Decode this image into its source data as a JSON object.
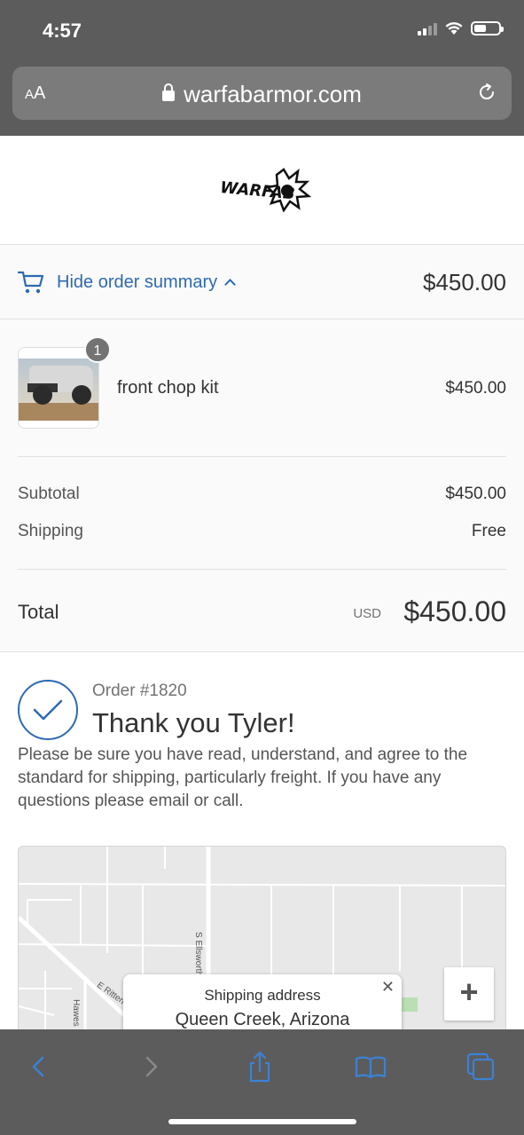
{
  "status": {
    "time": "4:57",
    "icons": [
      "cellular-signal-icon",
      "wifi-icon",
      "battery-icon"
    ]
  },
  "browser": {
    "text_size_label": "AA",
    "url": "warfabarmor.com",
    "toolbar_icons": [
      "back-icon",
      "forward-icon",
      "share-icon",
      "bookmarks-icon",
      "tabs-icon"
    ]
  },
  "header": {
    "logo_text": "WARFAB"
  },
  "order_summary": {
    "toggle_label": "Hide order summary",
    "toggle_total": "$450.00",
    "item": {
      "quantity": "1",
      "name": "front chop kit",
      "price": "$450.00"
    },
    "subtotal_label": "Subtotal",
    "subtotal_value": "$450.00",
    "shipping_label": "Shipping",
    "shipping_value": "Free",
    "total_label": "Total",
    "currency": "USD",
    "total_value": "$450.00"
  },
  "confirmation": {
    "order_number": "Order #1820",
    "thanks": "Thank you Tyler!",
    "note": "Please be sure you have read, understand, and agree to the standard for shipping, particularly freight. If you have any questions please email or call."
  },
  "map": {
    "street_labels": [
      "S Ellsworth",
      "E Ritten",
      "Hawes"
    ],
    "popup_title": "Shipping address",
    "popup_city": "Queen Creek, Arizona",
    "zoom_in_label": "+"
  },
  "colors": {
    "accent": "#2e6ab1",
    "chrome": "#5c5c5c"
  }
}
